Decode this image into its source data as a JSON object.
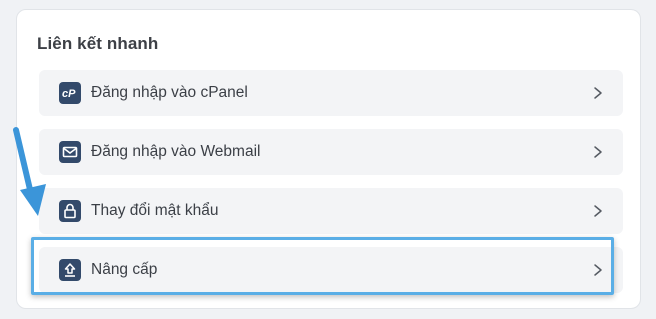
{
  "card": {
    "title": "Liên kết nhanh"
  },
  "links": [
    {
      "label": "Đăng nhập vào cPanel",
      "icon": "cpanel-icon"
    },
    {
      "label": "Đăng nhập vào Webmail",
      "icon": "envelope-icon"
    },
    {
      "label": "Thay đổi mật khẩu",
      "icon": "lock-icon"
    },
    {
      "label": "Nâng cấp",
      "icon": "upload-icon"
    }
  ],
  "colors": {
    "icon_bg": "#334a6b",
    "row_bg": "#f3f4f6",
    "highlight": "#5aaee6",
    "annotation_arrow": "#3b95d9"
  }
}
